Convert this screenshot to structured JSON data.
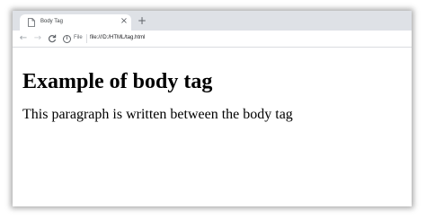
{
  "browser": {
    "tab": {
      "title": "Body Tag",
      "icon": "document-icon",
      "close_glyph": "×"
    },
    "new_tab_glyph": "+",
    "toolbar": {
      "back_glyph": "←",
      "forward_glyph": "→",
      "reload_glyph": "C",
      "info_glyph": "i",
      "scheme_label": "File",
      "url": "file:///D:/HTML/tag.html"
    }
  },
  "page": {
    "heading": "Example of body tag",
    "paragraph": "This paragraph is written between the body tag"
  }
}
